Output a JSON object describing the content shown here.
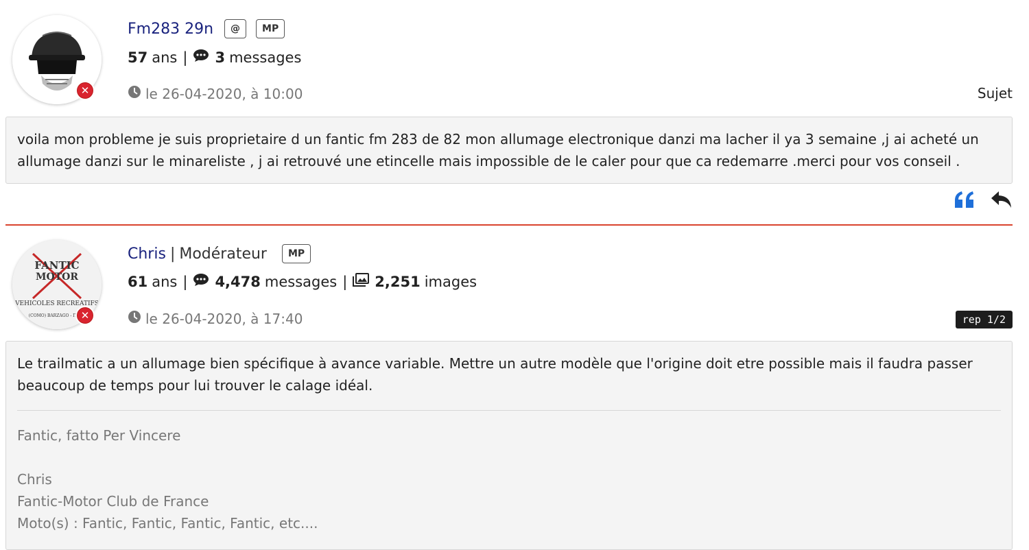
{
  "posts": [
    {
      "username": "Fm283 29n",
      "role": "",
      "buttons": {
        "at": "@",
        "mp": "MP"
      },
      "age_value": "57",
      "age_label": "ans",
      "sep": "|",
      "messages_value": "3",
      "messages_label": "messages",
      "date": "le 26-04-2020, à 10:00",
      "right_label": "Sujet",
      "body": "voila mon probleme je suis proprietaire d un fantic  fm 283 de 82 mon allumage electronique danzi  ma lacher il ya 3 semaine ,j ai acheté un allumage danzi sur le minareliste , j ai retrouvé une etincelle mais impossible de le caler pour que ca redemarre .merci pour vos conseil ."
    },
    {
      "username": "Chris",
      "role": "Modérateur",
      "role_sep": "|",
      "buttons": {
        "mp": "MP"
      },
      "age_value": "61",
      "age_label": "ans",
      "sep": "|",
      "messages_value": "4,478",
      "messages_label": "messages",
      "images_value": "2,251",
      "images_label": "images",
      "date": "le 26-04-2020, à 17:40",
      "right_label": "rep 1/2",
      "body": "Le trailmatic a un allumage bien spécifique à avance variable. Mettre un autre modèle que l'origine doit etre possible mais il faudra passer beaucoup de temps pour lui trouver le calage idéal.",
      "signature": {
        "line1": "Fantic, fatto Per Vincere",
        "line2": "Chris",
        "line3": "Fantic-Motor Club de France",
        "line4": "Moto(s) : Fantic, Fantic, Fantic, Fantic, etc...."
      },
      "avatar_text": {
        "top": "FANTIC",
        "top2": "MOTOR",
        "mid": "VEHICOLES RECREATIFS",
        "bottom": "(COMO) BARZAGO - ITALY"
      }
    }
  ],
  "colors": {
    "username": "#1a237e",
    "quote_icon": "#1e6fd9",
    "divider": "#d9432d",
    "status_badge": "#d9242f"
  },
  "icons": {
    "messages": "comment-icon",
    "images": "images-icon",
    "clock": "clock-icon",
    "quote": "quote-icon",
    "reply": "reply-icon",
    "status": "offline-x-icon"
  }
}
